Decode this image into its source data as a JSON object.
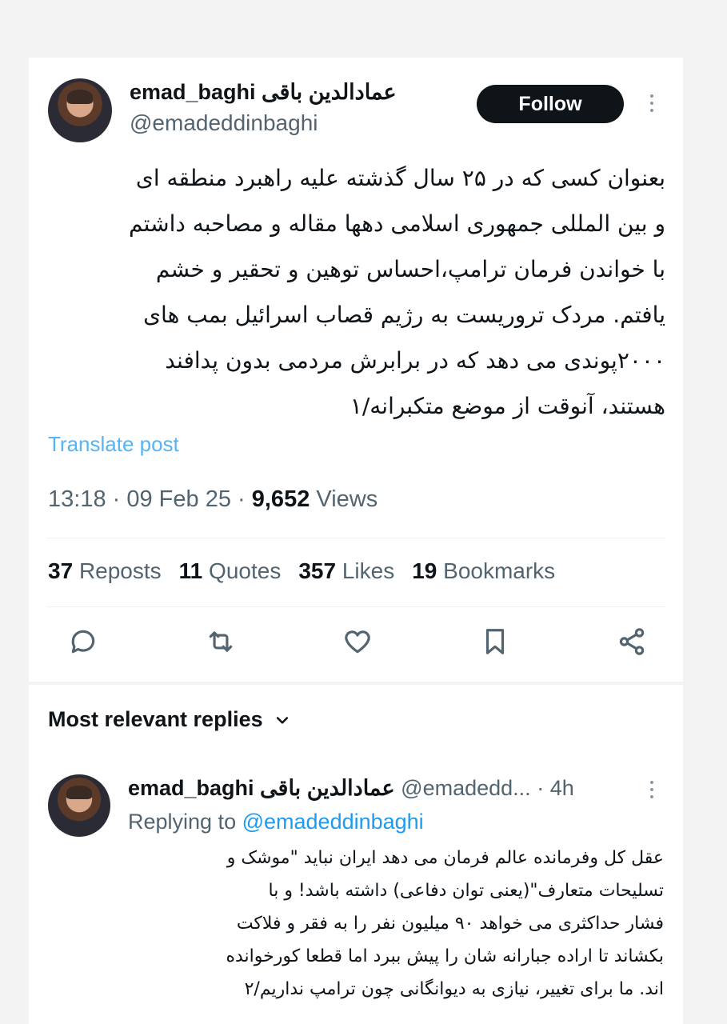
{
  "tweet": {
    "author_name": "emad_baghi عمادالدین باقی",
    "handle": "@emadeddinbaghi",
    "follow_label": "Follow",
    "text": "بعنوان کسی که در ۲۵ سال گذشته علیه راهبرد منطقه ای\nو بین المللی جمهوری اسلامی دهها مقاله و مصاحبه داشتم\nبا خواندن فرمان ترامپ،احساس توهین و تحقیر و خشم\nیافتم. مردک تروریست به رژیم قصاب اسرائیل بمب های\n۲۰۰۰پوندی می دهد که در برابرش مردمی بدون پدافند\nهستند، آنوقت از موضع متکبرانه/۱",
    "translate_label": "Translate post",
    "time": "13:18",
    "date": "09 Feb 25",
    "views_count": "9,652",
    "views_label": "Views"
  },
  "stats": {
    "reposts_count": "37",
    "reposts_label": "Reposts",
    "quotes_count": "11",
    "quotes_label": "Quotes",
    "likes_count": "357",
    "likes_label": "Likes",
    "bookmarks_count": "19",
    "bookmarks_label": "Bookmarks"
  },
  "actions": [
    "reply-icon",
    "repost-icon",
    "like-icon",
    "bookmark-icon",
    "share-icon"
  ],
  "replies_section": {
    "title": "Most relevant replies"
  },
  "reply": {
    "author_name": "emad_baghi عمادالدین باقی",
    "handle": "@emadedd...",
    "time": "4h",
    "replying_prefix": "Replying to",
    "replying_to": "@emadeddinbaghi",
    "text": "عقل کل وفرمانده عالم فرمان می دهد ایران نباید \"موشک و\nتسلیحات متعارف\"(یعنی توان دفاعی) داشته باشد! و با\nفشار حداکثری می خواهد ۹۰ میلیون نفر را به فقر و فلاکت\nبکشاند تا اراده جبارانه شان را پیش ببرد اما قطعا کورخوانده\nاند. ما برای تغییر، نیازی به دیوانگانی چون ترامپ نداریم/۲"
  },
  "colors": {
    "accent": "#1d9bf0",
    "text": "#0f1419",
    "muted": "#536471",
    "follow_bg": "#0f1419"
  }
}
